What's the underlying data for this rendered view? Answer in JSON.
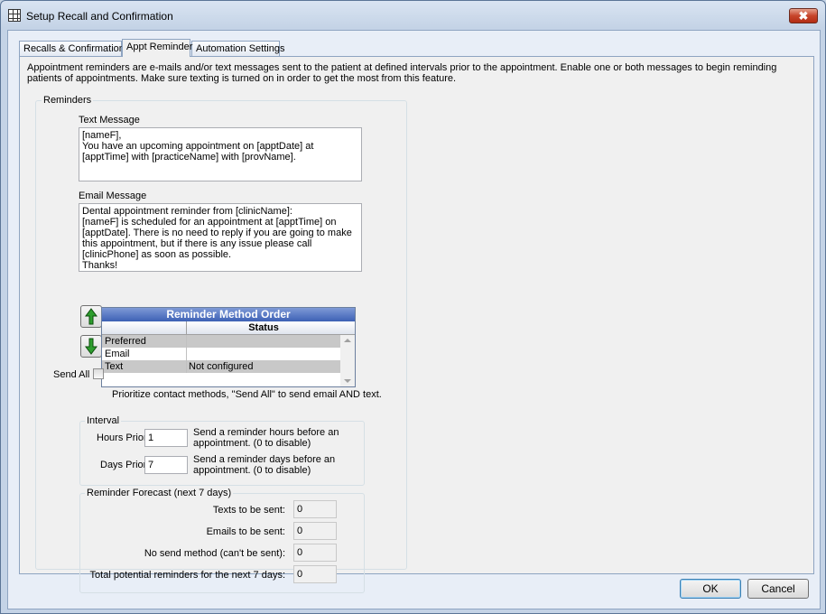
{
  "window": {
    "title": "Setup Recall and Confirmation",
    "close_glyph": "✖"
  },
  "tabs": [
    {
      "label": "Recalls & Confirmations",
      "active": false
    },
    {
      "label": "Appt Reminder",
      "active": true
    },
    {
      "label": "Automation Settings",
      "active": false
    }
  ],
  "description": "Appointment reminders are e-mails and/or text messages sent to the patient at defined intervals prior to the appointment.  Enable one or both messages to begin reminding patients of appointments.  Make sure texting is turned on in order to get the most from this feature.",
  "reminders": {
    "legend": "Reminders",
    "text_message_label": "Text Message",
    "text_message": "[nameF],\nYou have an upcoming appointment on [apptDate] at [apptTime] with [practiceName] with [provName].",
    "email_message_label": "Email Message",
    "email_message": "Dental appointment reminder from [clinicName]:\n[nameF] is scheduled for an appointment at [apptTime] on [apptDate]. There is no need to reply if you are going to make this appointment, but if there is any issue please call [clinicPhone] as soon as possible.\nThanks!"
  },
  "method_order": {
    "title": "Reminder Method Order",
    "status_header": "Status",
    "rows": [
      {
        "method": "Preferred",
        "status": ""
      },
      {
        "method": "Email",
        "status": ""
      },
      {
        "method": "Text",
        "status": "Not configured"
      }
    ],
    "send_all_label": "Send All",
    "send_all_checked": false,
    "hint": "Prioritize contact methods, \"Send All\" to send email AND text.",
    "up_icon": "green-up-arrow-icon",
    "down_icon": "green-down-arrow-icon"
  },
  "interval": {
    "legend": "Interval",
    "hours_label": "Hours Prior",
    "hours_value": "1",
    "hours_desc": "Send a reminder hours before an appointment. (0 to disable)",
    "days_label": "Days Prior",
    "days_value": "7",
    "days_desc": "Send a reminder days before an appointment. (0 to disable)"
  },
  "forecast": {
    "legend": "Reminder Forecast (next 7 days)",
    "texts_label": "Texts to be sent:",
    "texts_value": "0",
    "emails_label": "Emails to be sent:",
    "emails_value": "0",
    "nosend_label": "No send method (can't be sent):",
    "nosend_value": "0",
    "total_label": "Total potential reminders for the next 7 days:",
    "total_value": "0"
  },
  "buttons": {
    "ok": "OK",
    "cancel": "Cancel"
  },
  "colors": {
    "accent_green": "#2e9e2e",
    "grid_header_blue": "#3d60b5",
    "close_red": "#c7452b"
  }
}
